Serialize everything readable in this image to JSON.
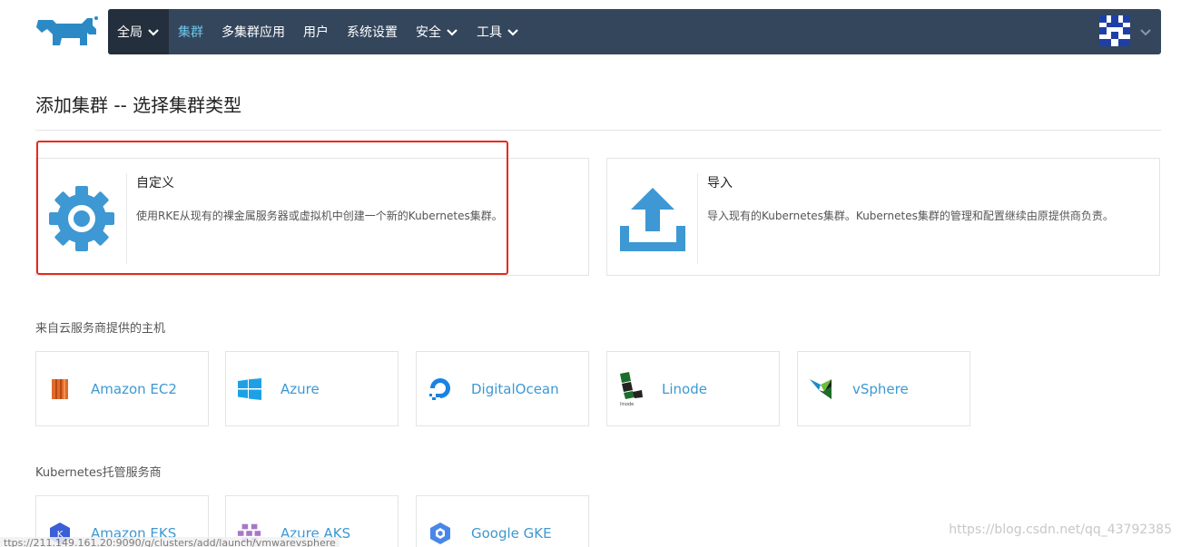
{
  "nav": {
    "global": "全局",
    "items": [
      "集群",
      "多集群应用",
      "用户",
      "系统设置",
      "安全",
      "工具"
    ]
  },
  "title": "添加集群 -- 选择集群类型",
  "custom": {
    "title": "自定义",
    "desc": "使用RKE从现有的裸金属服务器或虚拟机中创建一个新的Kubernetes集群。"
  },
  "import": {
    "title": "导入",
    "desc": "导入现有的Kubernetes集群。Kubernetes集群的管理和配置继续由原提供商负责。"
  },
  "cloud_section": "来自云服务商提供的主机",
  "cloud_providers": [
    "Amazon EC2",
    "Azure",
    "DigitalOcean",
    "Linode",
    "vSphere"
  ],
  "k8s_section": "Kubernetes托管服务商",
  "k8s_providers": [
    "Amazon EKS",
    "Azure AKS",
    "Google GKE"
  ],
  "status_url": "ttps://211.149.161.20:9090/g/clusters/add/launch/vmwarevsphere",
  "watermark": "https://blog.csdn.net/qq_43792385",
  "colors": {
    "nav_bg": "#34465c",
    "accent": "#3d98d3",
    "highlight": "#e8291c"
  }
}
